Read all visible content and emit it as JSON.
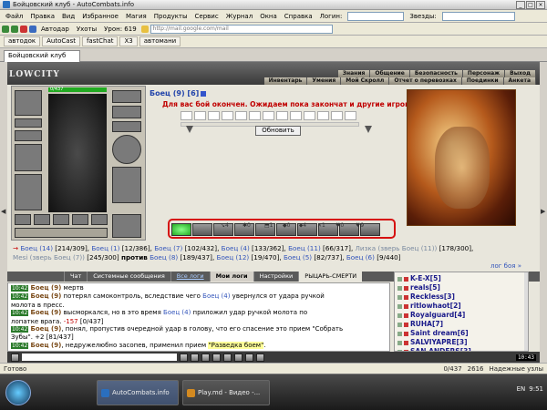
{
  "window": {
    "title": "Бойцовский клуб - AutoCombats.info"
  },
  "menu": {
    "items": [
      "Файл",
      "Правка",
      "Вид",
      "Избранное",
      "Магия",
      "Продукты",
      "Сервис",
      "Журнал",
      "Окна",
      "Справка"
    ],
    "login_label": "Логин:",
    "stars_label": "Звезды:"
  },
  "toolbar": {
    "autodar": "Автодар",
    "uhoty": "Ухоты",
    "uron": "Урон: 619",
    "address": "http://mail.google.com/mail"
  },
  "links": [
    "автодок",
    "AutoCast",
    "fastChat",
    "X3",
    "автомани"
  ],
  "tab": {
    "label": "Бойцовский клуб"
  },
  "game": {
    "logo": "LOWCITY",
    "nav_top": [
      "Знания",
      "Общение",
      "Безопасность",
      "Персонаж",
      "Выход"
    ],
    "nav_bottom": [
      "Инвентарь",
      "Умения",
      "Мой Скролл",
      "Отчет о перевозках",
      "Поединки",
      "Анкета"
    ],
    "hp": "0/437",
    "player": {
      "name": "Боец (9)",
      "level": "[6]"
    },
    "message": "Для вас бой окончен. Ожидаем пока закончат и другие игроки...",
    "refresh": "Обновить",
    "skill_counts": [
      "4",
      "0",
      "1",
      "0",
      "4",
      "1",
      "0",
      "9"
    ],
    "fight": {
      "line1_pre": "→",
      "line1": [
        {
          "t": "Боец (14)",
          "c": "blue"
        },
        {
          "t": " [214/309],  ",
          "c": ""
        },
        {
          "t": "Боец (1)",
          "c": "blue"
        },
        {
          "t": " [12/386],  ",
          "c": ""
        },
        {
          "t": "Боец (7)",
          "c": "blue"
        },
        {
          "t": " [102/432],  ",
          "c": ""
        },
        {
          "t": "Боец (4)",
          "c": "blue"
        },
        {
          "t": " [133/362],  ",
          "c": ""
        },
        {
          "t": "Боец (11)",
          "c": "blue"
        },
        {
          "t": " [66/317],  ",
          "c": ""
        },
        {
          "t": "Лизка (зверь Боец (11))",
          "c": "grey"
        },
        {
          "t": " [178/300],",
          "c": ""
        }
      ],
      "line2": [
        {
          "t": "Mesi (зверь Боец (7))",
          "c": "grey"
        },
        {
          "t": " [245/300]  ",
          "c": ""
        },
        {
          "t": "против",
          "c": "bold"
        },
        {
          "t": "  ",
          "c": ""
        },
        {
          "t": "Боец (8)",
          "c": "blue"
        },
        {
          "t": " [189/437],  ",
          "c": ""
        },
        {
          "t": "Боец (12)",
          "c": "blue"
        },
        {
          "t": " [19/470],  ",
          "c": ""
        },
        {
          "t": "Боец (5)",
          "c": "blue"
        },
        {
          "t": " [82/737],  ",
          "c": ""
        },
        {
          "t": "Боец (6)",
          "c": "blue"
        },
        {
          "t": " [9/440]",
          "c": ""
        }
      ],
      "log_link": "лог боя »"
    },
    "chat_tabs": [
      "Чат",
      "Системные сообщения",
      "Все логи",
      "Мои логи",
      "Настройки",
      "РЫЦАРЬ-СМЕРТИ"
    ],
    "chat": [
      [
        {
          "t": "10:42",
          "c": "ts"
        },
        {
          "t": " ",
          "c": ""
        },
        {
          "t": "Боец (9)",
          "c": "brown"
        },
        {
          "t": " мертв",
          "c": ""
        }
      ],
      [
        {
          "t": "10:42",
          "c": "ts"
        },
        {
          "t": " ",
          "c": ""
        },
        {
          "t": "Боец (9)",
          "c": "brown"
        },
        {
          "t": " потерял самоконтроль, вследствие чего ",
          "c": ""
        },
        {
          "t": "Боец (4)",
          "c": "blue"
        },
        {
          "t": " увернулся от удара ручкой",
          "c": ""
        }
      ],
      [
        {
          "t": "молота в пресс.",
          "c": ""
        }
      ],
      [
        {
          "t": "10:42",
          "c": "ts"
        },
        {
          "t": " ",
          "c": ""
        },
        {
          "t": "Боец (9)",
          "c": "brown"
        },
        {
          "t": " высморкался, но в это время ",
          "c": ""
        },
        {
          "t": "Боец (4)",
          "c": "blue"
        },
        {
          "t": " приложил удар ручкой молота по",
          "c": ""
        }
      ],
      [
        {
          "t": "лопатке врага. ",
          "c": ""
        },
        {
          "t": "-157",
          "c": "red"
        },
        {
          "t": " [0/437]",
          "c": ""
        }
      ],
      [
        {
          "t": "10:42",
          "c": "ts"
        },
        {
          "t": " ",
          "c": ""
        },
        {
          "t": "Боец (9)",
          "c": "brown"
        },
        {
          "t": ", понял, пропустив очередной удар в голову, что его спасение это прием \"Собрать",
          "c": ""
        }
      ],
      [
        {
          "t": "Зубы\". +2 [81/437]",
          "c": ""
        }
      ],
      [
        {
          "t": "10:42",
          "c": "ts"
        },
        {
          "t": " ",
          "c": ""
        },
        {
          "t": "Боец (9)",
          "c": "brown"
        },
        {
          "t": ", недружелюбно засопев, применил прием ",
          "c": ""
        },
        {
          "t": "\"Разведка боем\"",
          "c": "hl"
        },
        {
          "t": ".",
          "c": ""
        }
      ]
    ],
    "users": [
      "K-E-X[5]",
      "reals[5]",
      "Reckless[3]",
      "ritlowhaot[2]",
      "Royalguard[4]",
      "RUHA[7]",
      "Saint dream[6]",
      "SALVIYAPRE[3]",
      "SAN ANDERS[3]"
    ],
    "clock": "10:43"
  },
  "status": {
    "left": "Готово",
    "counter": "0/437",
    "value": "2616",
    "right": "Надежные узлы"
  },
  "taskbar": {
    "tasks": [
      "AutoCombats.info",
      "Play.md - Видео -..."
    ],
    "time": "9:51",
    "lang": "EN"
  }
}
